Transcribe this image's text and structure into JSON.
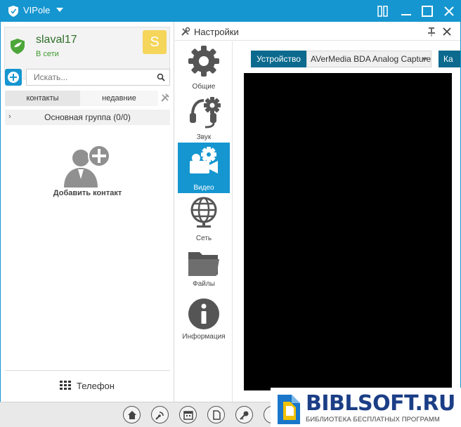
{
  "window": {
    "title": "VIPole",
    "controls": [
      "panels-icon",
      "minimize-icon",
      "maximize-icon",
      "close-icon"
    ]
  },
  "profile": {
    "username": "slaval17",
    "status": "В сети",
    "avatar_letter": "S",
    "avatar_color": "#f5d55a"
  },
  "contacts": {
    "search_placeholder": "Искать...",
    "tabs": [
      {
        "label": "контакты",
        "active": true
      },
      {
        "label": "недавние",
        "active": false
      }
    ],
    "group": {
      "label": "Основная группа (0/0)",
      "chevron": "›"
    },
    "add_contact_label": "Добавить контакт",
    "phone_label": "Телефон"
  },
  "settings": {
    "title": "Настройки",
    "nav": [
      {
        "label": "Общие",
        "icon": "gear-icon",
        "active": false
      },
      {
        "label": "Звук",
        "icon": "headset-icon",
        "active": false
      },
      {
        "label": "Видео",
        "icon": "camera-icon",
        "active": true
      },
      {
        "label": "Сеть",
        "icon": "globe-icon",
        "active": false
      },
      {
        "label": "Файлы",
        "icon": "folder-icon",
        "active": false
      },
      {
        "label": "Информация",
        "icon": "info-icon",
        "active": false
      }
    ],
    "device_label": "Устройство",
    "device_value": "AVerMedia BDA Analog Capture",
    "cut_button_text": "Ка"
  },
  "bottom_bar": {
    "icons": [
      "home-icon",
      "radar-icon",
      "calendar-icon",
      "document-icon",
      "key-icon",
      "info-icon"
    ]
  },
  "watermark": {
    "title": "BIBLSOFT.RU",
    "subtitle": "БИБЛИОТЕКА БЕСПЛАТНЫХ ПРОГРАММ"
  },
  "colors": {
    "accent": "#1596d0",
    "dark_accent": "#0b6a8e",
    "online_green": "#3f9a2f",
    "watermark_blue": "#1b3e86"
  }
}
